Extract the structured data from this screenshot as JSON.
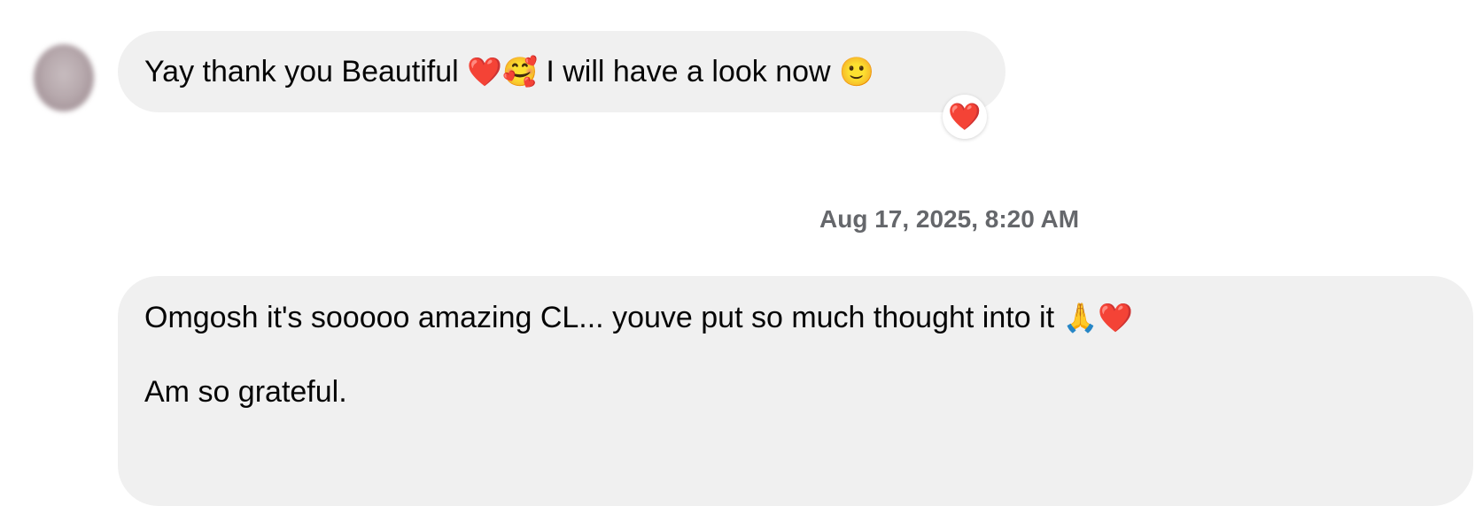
{
  "conversation": {
    "received_message": {
      "text": "Yay thank you Beautiful",
      "emojis_mid": "❤️🥰",
      "text_after": "I will have a look now",
      "emoji_end": "🙂",
      "reaction": "❤️"
    },
    "timestamp": "Aug 17, 2025, 8:20 AM",
    "sent_message": {
      "line1_text": "Omgosh it's sooooo amazing CL... youve put so much thought into it",
      "line1_emojis": "🙏❤️",
      "line2_text": "Am so grateful."
    }
  },
  "colors": {
    "bubble_bg": "#f0f0f0",
    "timestamp_text": "#65676b",
    "heart": "#e41e3f"
  },
  "icons": {
    "avatar": "blurred-profile-avatar",
    "reaction": "heart-reaction-icon"
  }
}
